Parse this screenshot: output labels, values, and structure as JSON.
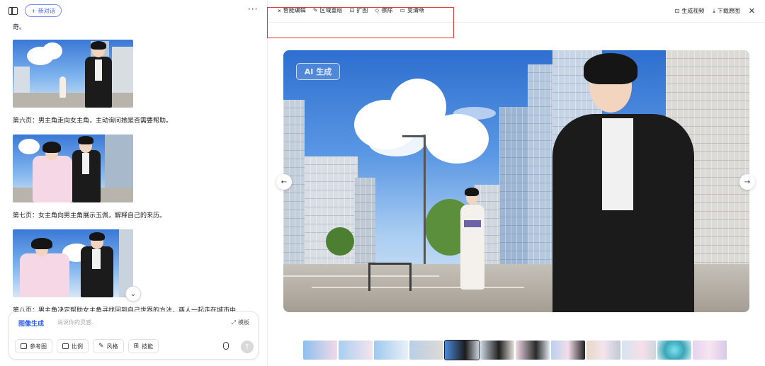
{
  "left_header": {
    "new_chat_label": "新对话"
  },
  "feed": {
    "partial_text": "奇。",
    "captions": [
      "第六页：男主角走向女主角，主动询问她是否需要帮助。",
      "第七页：女主角向男主角展示玉佩，解释自己的来历。",
      "第八页：男主角决定帮助女主角寻找回到自己世界的方法，两人一起走在城市中"
    ]
  },
  "composer": {
    "mode_label": "图像生成",
    "placeholder": "说说你的灵感...",
    "template_label": "模板",
    "chips": [
      {
        "label": "参考图",
        "icon": "image-icon"
      },
      {
        "label": "比例",
        "icon": "ratio-icon"
      },
      {
        "label": "风格",
        "icon": "brush-icon"
      },
      {
        "label": "技能",
        "icon": "grid-icon"
      }
    ]
  },
  "toolbar": {
    "tools": [
      {
        "label": "智能编辑",
        "icon": "magic-wand-icon"
      },
      {
        "label": "区域重绘",
        "icon": "brush-icon"
      },
      {
        "label": "扩图",
        "icon": "expand-icon"
      },
      {
        "label": "擦除",
        "icon": "eraser-icon"
      },
      {
        "label": "变清晰",
        "icon": "hd-icon"
      }
    ],
    "generate_video_label": "生成视频",
    "download_label": "下载原图"
  },
  "preview": {
    "watermark": "AI 生成"
  },
  "colors": {
    "accent": "#2f5cf5",
    "highlight_box": "#e23a3a"
  }
}
